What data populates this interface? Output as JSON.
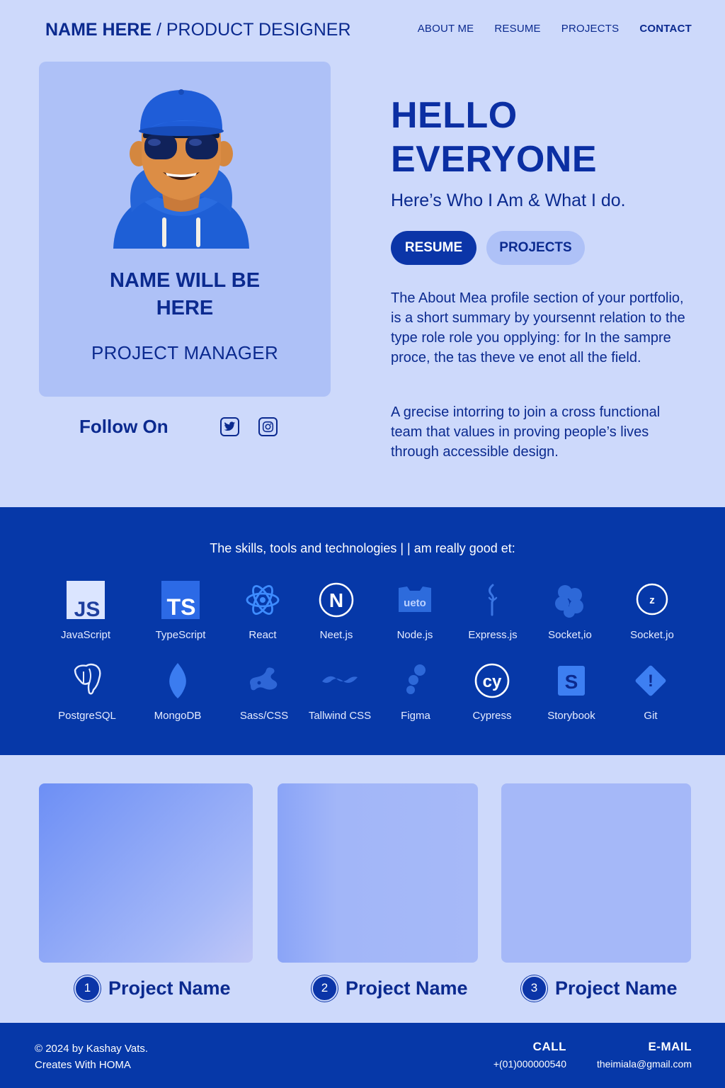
{
  "nav": {
    "brand_name": "NAME HERE",
    "brand_role": " / PRODUCT DESIGNER",
    "items": [
      {
        "label": "ABOUT ME"
      },
      {
        "label": "RESUME"
      },
      {
        "label": "PROJECTS"
      },
      {
        "label": "CONTACT"
      }
    ]
  },
  "profile": {
    "name_line1": "NAME WILL BE",
    "name_line2": "HERE",
    "role": "PROJECT MANAGER",
    "follow_label": "Follow On",
    "social_icons": [
      "twitter-icon",
      "instagram-icon"
    ]
  },
  "hero": {
    "title_line1": "HELLO",
    "title_line2": "EVERYONE",
    "tagline": "Here’s Who I Am & What I do.",
    "buttons": {
      "resume": "RESUME",
      "projects": "PROJECTS"
    },
    "para1": "The About Mea profile section of your portfolio, is a short summary by yoursennt relation to the type role role you opplying: for In the sampre proce, the tas theve ve enot all the field.",
    "para2": "A grecise intorring to join a cross functional team that values in proving people’s lives through accessible design."
  },
  "skills": {
    "title": "The skills, tools and technologies | | am really good et:",
    "items": [
      {
        "label": "JavaScript",
        "icon": "javascript-icon"
      },
      {
        "label": "TypeScript",
        "icon": "typescript-icon"
      },
      {
        "label": "React",
        "icon": "react-icon"
      },
      {
        "label": "Neet.js",
        "icon": "nextjs-icon"
      },
      {
        "label": "Node.js",
        "icon": "nodejs-icon",
        "icon_text": "ueto"
      },
      {
        "label": "Express.js",
        "icon": "express-icon"
      },
      {
        "label": "Socket,io",
        "icon": "socketio-icon"
      },
      {
        "label": "Socket.jo",
        "icon": "socket-icon"
      },
      {
        "label": "PostgreSQL",
        "icon": "postgresql-icon"
      },
      {
        "label": "MongoDB",
        "icon": "mongodb-icon"
      },
      {
        "label": "Sass/CSS",
        "icon": "sass-icon"
      },
      {
        "label": "Tallwind CSS",
        "icon": "tailwind-icon"
      },
      {
        "label": "Figma",
        "icon": "figma-icon"
      },
      {
        "label": "Cypress",
        "icon": "cypress-icon"
      },
      {
        "label": "Storybook",
        "icon": "storybook-icon"
      },
      {
        "label": "Git",
        "icon": "git-icon"
      }
    ]
  },
  "projects": [
    {
      "num": "1",
      "name": "Project Name"
    },
    {
      "num": "2",
      "name": "Project Name"
    },
    {
      "num": "3",
      "name": "Project Name"
    }
  ],
  "footer": {
    "copy_line1": "© 2024 by Kashay Vats.",
    "copy_line2": "Creates With HOMA",
    "call_label": "CALL",
    "call_value": "+(01)000000540",
    "email_label": "E-MAIL",
    "email_value": "theimiala@gmail.com"
  },
  "colors": {
    "page_bg": "#cdd9fb",
    "card_bg": "#aec1f7",
    "primary": "#0b35a8",
    "text": "#0b2a8f",
    "band_bg": "#0638a8"
  }
}
